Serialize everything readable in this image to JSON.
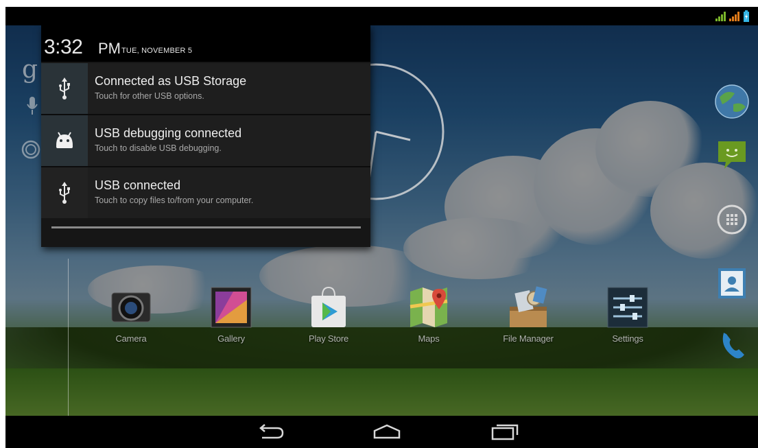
{
  "status_bar": {
    "icons": [
      "signal-bars-icon",
      "signal-bars-icon",
      "battery-charging-icon"
    ],
    "accent": "#33b5e5",
    "signal_color": "#7ab52a"
  },
  "notification_shade": {
    "time": "3:32",
    "ampm": "PM",
    "date": "TUE, NOVEMBER 5",
    "notifications": [
      {
        "icon": "usb-icon",
        "title": "Connected as USB Storage",
        "subtitle": "Touch for other USB options."
      },
      {
        "icon": "android-debug-icon",
        "title": "USB debugging connected",
        "subtitle": "Touch to disable USB debugging."
      },
      {
        "icon": "usb-icon",
        "title": "USB connected",
        "subtitle": "Touch to copy files to/from your computer."
      }
    ]
  },
  "home": {
    "apps": [
      {
        "label": "Camera",
        "icon": "camera-icon"
      },
      {
        "label": "Gallery",
        "icon": "gallery-icon"
      },
      {
        "label": "Play Store",
        "icon": "play-store-icon"
      },
      {
        "label": "Maps",
        "icon": "maps-icon"
      },
      {
        "label": "File Manager",
        "icon": "file-manager-icon"
      },
      {
        "label": "Settings",
        "icon": "settings-icon"
      }
    ],
    "dock": [
      "browser-globe-icon",
      "messaging-icon",
      "app-drawer-icon",
      "contacts-icon",
      "phone-icon"
    ],
    "widgets": [
      "google-search-icon",
      "mic-icon",
      "analog-clock"
    ]
  },
  "nav_bar": {
    "buttons": [
      "back-icon",
      "home-icon",
      "recent-apps-icon"
    ]
  }
}
